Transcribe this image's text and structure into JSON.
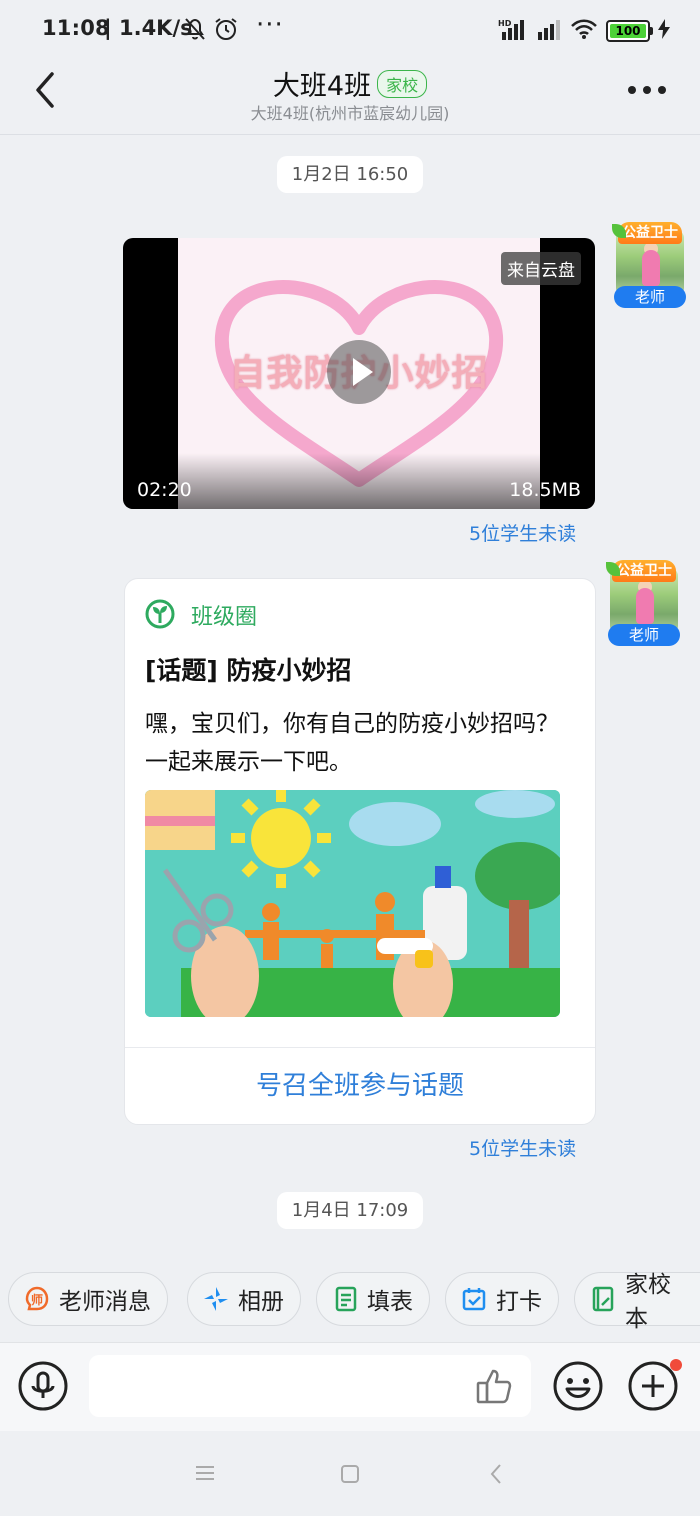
{
  "status_bar": {
    "time": "11:08",
    "speed": "| 1.4K/s",
    "overflow": "···",
    "network": "HD",
    "battery": "100"
  },
  "header": {
    "title": "大班4班",
    "badge": "家校",
    "subtitle": "大班4班(杭州市蓝宸幼儿园)"
  },
  "messages": {
    "stamp1": "1月2日 16:50",
    "video": {
      "title_overlay": "自我防护小妙招",
      "source_tag": "来自云盘",
      "duration": "02:20",
      "size": "18.5MB"
    },
    "unread1": "5位学生未读",
    "avatar": {
      "banner": "公益卫士",
      "role": "老师"
    },
    "card": {
      "brand": "班级圈",
      "topic": "[话题] 防疫小妙招",
      "description": "嘿，宝贝们，你有自己的防疫小妙招吗？一起来展示一下吧。",
      "cta": "号召全班参与话题"
    },
    "unread2": "5位学生未读",
    "stamp2": "1月4日 17:09"
  },
  "quick_actions": [
    {
      "label": "老师消息",
      "icon": "teacher-icon",
      "color": "#f06a2a"
    },
    {
      "label": "相册",
      "icon": "album-icon",
      "color": "#1f8ef0"
    },
    {
      "label": "填表",
      "icon": "form-icon",
      "color": "#27a35a"
    },
    {
      "label": "打卡",
      "icon": "checkin-icon",
      "color": "#1f8ef0"
    },
    {
      "label": "家校本",
      "icon": "notebook-icon",
      "color": "#27a35a"
    }
  ],
  "input_bar": {
    "icons": [
      "microphone-icon",
      "thumbs-up-icon",
      "emoji-icon",
      "plus-icon"
    ]
  },
  "colors": {
    "accent_blue": "#2f7fd9",
    "brand_green": "#2eaa5f",
    "badge_green": "#3bb54a",
    "teacher_blue": "#1f7cf0"
  }
}
